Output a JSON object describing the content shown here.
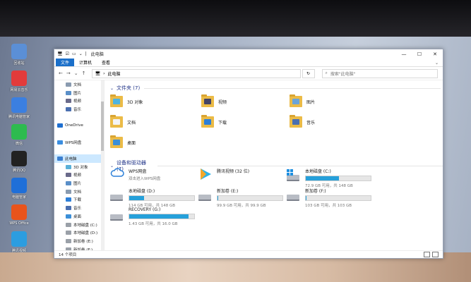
{
  "desktop_icons": [
    {
      "label": "回收站",
      "color": "#5b8fd6"
    },
    {
      "label": "网易云音乐",
      "color": "#e23b3b"
    },
    {
      "label": "腾讯电脑管家",
      "color": "#3b7fe0"
    },
    {
      "label": "微信",
      "color": "#2dbb4f"
    },
    {
      "label": "腾讯QQ",
      "color": "#222222"
    },
    {
      "label": "电脑管家",
      "color": "#1f6fd8"
    },
    {
      "label": "WPS Office",
      "color": "#e8541c"
    },
    {
      "label": "腾讯视频",
      "color": "#2c9de0"
    }
  ],
  "titlebar": {
    "title": "此电脑",
    "minimize": "—",
    "maximize": "☐",
    "close": "✕"
  },
  "ribbon": {
    "tabs": [
      "文件",
      "计算机",
      "查看"
    ],
    "expand": "⌄"
  },
  "address": {
    "back": "←",
    "forward": "→",
    "history": "⌄",
    "up": "↑",
    "path": "此电脑",
    "refresh": "↻",
    "search_placeholder": "搜索\"此电脑\""
  },
  "nav_pane": [
    {
      "label": "文档",
      "color": "#8a9bb0"
    },
    {
      "label": "图片",
      "color": "#5a8fc8"
    },
    {
      "label": "视频",
      "color": "#6a6a8a"
    },
    {
      "label": "音乐",
      "color": "#4a6fb0"
    },
    {
      "label": "",
      "color": "transparent"
    },
    {
      "label": "OneDrive",
      "color": "#1e6fd0"
    },
    {
      "label": "",
      "color": "transparent"
    },
    {
      "label": "WPS网盘",
      "color": "#3b8ee0"
    },
    {
      "label": "",
      "color": "transparent"
    },
    {
      "label": "此电脑",
      "color": "#3b7fd0",
      "selected": true
    },
    {
      "label": "3D 对象",
      "color": "#5ab0d8"
    },
    {
      "label": "视频",
      "color": "#6a6a8a"
    },
    {
      "label": "图片",
      "color": "#5a8fc8"
    },
    {
      "label": "文档",
      "color": "#8a9bb0"
    },
    {
      "label": "下载",
      "color": "#2d7fd8"
    },
    {
      "label": "音乐",
      "color": "#4a6fb0"
    },
    {
      "label": "桌面",
      "color": "#3b8fd8"
    },
    {
      "label": "本地磁盘 (C:)",
      "color": "#9aa0a8"
    },
    {
      "label": "本地磁盘 (D:)",
      "color": "#9aa0a8"
    },
    {
      "label": "新加卷 (E:)",
      "color": "#9aa0a8"
    },
    {
      "label": "新加卷 (F:)",
      "color": "#9aa0a8"
    },
    {
      "label": "RECOVERY (G:)",
      "color": "#9aa0a8"
    }
  ],
  "folders_section": {
    "title": "文件夹 (7)"
  },
  "folders": [
    {
      "label": "3D 对象",
      "overlay": "#4fb4e0"
    },
    {
      "label": "视频",
      "overlay": "#444466"
    },
    {
      "label": "图片",
      "overlay": "#6ba4d8"
    },
    {
      "label": "文档",
      "overlay": "#f4f4f4"
    },
    {
      "label": "下载",
      "overlay": "#2d7fd8"
    },
    {
      "label": "音乐",
      "overlay": "#4a6fb0"
    },
    {
      "label": "桌面",
      "overlay": "#3b8fd8"
    }
  ],
  "devices_section": {
    "title": "设备和驱动器 (7)"
  },
  "devices": [
    {
      "label": "WPS网盘",
      "free": "双击进入WPS网盘",
      "kind": "cloud"
    },
    {
      "label": "腾讯视频 (32 位)",
      "free": "",
      "kind": "app"
    },
    {
      "label": "本地磁盘 (C:)",
      "free": "72.9 GB 可用，共 148 GB",
      "used_fraction": 0.51,
      "kind": "win"
    },
    {
      "label": "本地磁盘 (D:)",
      "free": "114 GB 可用，共 148 GB",
      "used_fraction": 0.23,
      "kind": "hd"
    },
    {
      "label": "新加卷 (E:)",
      "free": "99.9 GB 可用，共 99.9 GB",
      "used_fraction": 0.01,
      "kind": "hd"
    },
    {
      "label": "新加卷 (F:)",
      "free": "103 GB 可用，共 103 GB",
      "used_fraction": 0.01,
      "kind": "hd"
    },
    {
      "label": "RECOVERY (G:)",
      "free": "1.43 GB 可用，共 16.0 GB",
      "used_fraction": 0.91,
      "kind": "hd"
    }
  ],
  "status": {
    "count": "14 个项目"
  }
}
